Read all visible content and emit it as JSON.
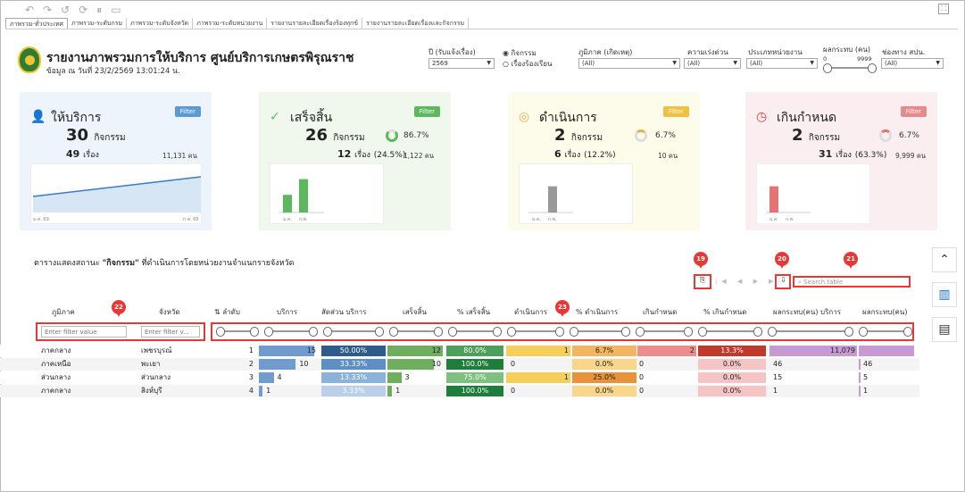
{
  "tabs": [
    "ภาพรวม-ทั่วประเทศ",
    "ภาพรวม-ระดับกรม",
    "ภาพรวม-ระดับจังหวัด",
    "ภาพรวม-ระดับหน่วยงาน",
    "รายงานรายละเอียดเรื่องร้องทุกข์",
    "รายงานรายละเอียดเรื่องและกิจกรรม"
  ],
  "header": {
    "title": "รายงานภาพรวมการให้บริการ ศูนย์บริการเกษตรพิรุณราช",
    "subtitle": "ข้อมูล ณ วันที่ 23/2/2569 13:01:24 น."
  },
  "filters": {
    "year_label": "ปี (รับแจ้งเรื่อง)",
    "year_value": "2569",
    "radio1": "กิจกรรม",
    "radio2": "เรื่องร้องเรียน",
    "region_label": "ภูมิภาค (เกิดเหตุ)",
    "region_value": "(All)",
    "urgency_label": "ความเร่งด่วน",
    "urgency_value": "(All)",
    "agency_label": "ประเภทหน่วยงาน",
    "agency_value": "(All)",
    "impact_label": "ผลกระทบ (คน)",
    "impact_min": "0",
    "impact_max": "9999",
    "channel_label": "ช่องทาง สปน.",
    "channel_value": "(All)"
  },
  "cards": [
    {
      "label": "ให้บริการ",
      "filter": "Filter",
      "activities": "30",
      "activities_unit": "กิจกรรม",
      "stories": "49",
      "stories_unit": "เรื่อง",
      "people": "11,131 คน",
      "x_start": "ม.ค. 69",
      "x_end": "ก.พ. 69"
    },
    {
      "label": "เสร็จสิ้น",
      "filter": "Filter",
      "activities": "26",
      "activities_unit": "กิจกรรม",
      "pct": "86.7%",
      "stories": "12",
      "stories_unit": "เรื่อง",
      "stories_pct": "(24.5%)",
      "people": "1,122 คน",
      "bars": [
        {
          "x": "ม.ค.",
          "v": 9
        },
        {
          "x": "ก.พ.",
          "v": 17
        }
      ]
    },
    {
      "label": "ดำเนินการ",
      "filter": "Filter",
      "activities": "2",
      "activities_unit": "กิจกรรม",
      "pct": "6.7%",
      "stories": "6",
      "stories_unit": "เรื่อง",
      "stories_pct": "(12.2%)",
      "people": "10 คน",
      "bars": [
        {
          "x": "ม.ค.",
          "v": 0
        },
        {
          "x": "ก.พ.",
          "v": 2
        }
      ]
    },
    {
      "label": "เกินกำหนด",
      "filter": "Filter",
      "activities": "2",
      "activities_unit": "กิจกรรม",
      "pct": "6.7%",
      "stories": "31",
      "stories_unit": "เรื่อง",
      "stories_pct": "(63.3%)",
      "people": "9,999 คน",
      "bars": [
        {
          "x": "ม.ค.",
          "v": 2
        },
        {
          "x": "ก.พ.",
          "v": 0
        }
      ]
    }
  ],
  "table": {
    "title_prefix": "ตารางแสดงสถานะ",
    "title_bold": "\"กิจกรรม\"",
    "title_suffix": "ที่ดำเนินการโดยหน่วยงานจำแนกรายจังหวัด",
    "search_placeholder": "Search table",
    "filter_placeholder": "Enter filter value",
    "filter_placeholder2": "Enter filter v...",
    "headers": [
      "ภูมิภาค",
      "จังหวัด",
      "ลำดับ",
      "บริการ",
      "สัดส่วน บริการ",
      "เสร็จสิ้น",
      "% เสร็จสิ้น",
      "ดำเนินการ",
      "% ดำเนินการ",
      "เกินกำหนด",
      "% เกินกำหนด",
      "ผลกระทบ(คน) บริการ",
      "ผลกระทบ(คน)"
    ],
    "rows": [
      {
        "region": "ภาคกลาง",
        "province": "เพชรบุรณ์",
        "rank": "1",
        "service": "15",
        "share": "50.00%",
        "done": "12",
        "done_pct": "80.0%",
        "prog": "1",
        "prog_pct": "6.7%",
        "over": "2",
        "over_pct": "13.3%",
        "imp": "11,079",
        "imp2": ""
      },
      {
        "region": "ภาคเหนือ",
        "province": "พะเยา",
        "rank": "2",
        "service": "10",
        "share": "33.33%",
        "done": "10",
        "done_pct": "100.0%",
        "prog": "0",
        "prog_pct": "0.0%",
        "over": "0",
        "over_pct": "0.0%",
        "imp": "46",
        "imp2": "46"
      },
      {
        "region": "ส่วนกลาง",
        "province": "ส่วนกลาง",
        "rank": "3",
        "service": "4",
        "share": "13.33%",
        "done": "3",
        "done_pct": "75.0%",
        "prog": "1",
        "prog_pct": "25.0%",
        "over": "0",
        "over_pct": "0.0%",
        "imp": "15",
        "imp2": "5"
      },
      {
        "region": "ภาคกลาง",
        "province": "สิงห์บุรี",
        "rank": "4",
        "service": "1",
        "share": "3.33%",
        "done": "1",
        "done_pct": "100.0%",
        "prog": "0",
        "prog_pct": "0.0%",
        "over": "0",
        "over_pct": "0.0%",
        "imp": "1",
        "imp2": "1"
      }
    ]
  },
  "pins": {
    "p19": "19",
    "p20": "20",
    "p21": "21",
    "p22": "22",
    "p23": "23"
  },
  "colors": {
    "green": "#5cb85c",
    "orange": "#f0ad4e",
    "red": "#e57373",
    "blue": "#5b9bd5"
  }
}
